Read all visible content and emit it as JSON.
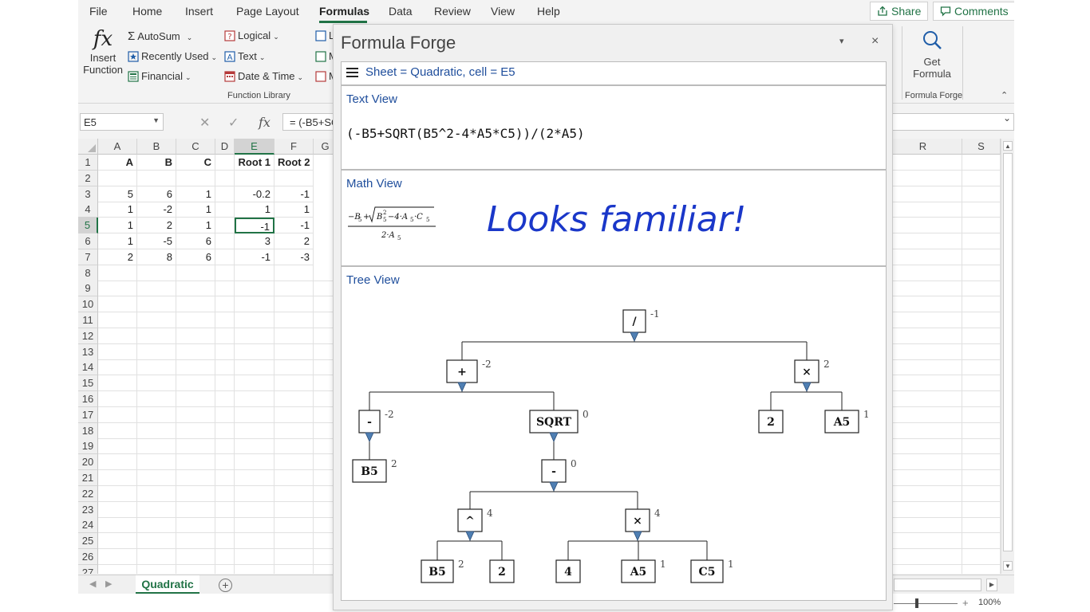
{
  "menu": {
    "tabs": [
      "File",
      "Home",
      "Insert",
      "Page Layout",
      "Formulas",
      "Data",
      "Review",
      "View",
      "Help"
    ],
    "active_tab": "Formulas",
    "share_label": "Share",
    "comments_label": "Comments"
  },
  "ribbon": {
    "insert_function_line1": "Insert",
    "insert_function_line2": "Function",
    "fx_glyph": "fx",
    "autosum": "AutoSum",
    "recently_used": "Recently Used",
    "financial": "Financial",
    "logical": "Logical",
    "text": "Text",
    "date_time": "Date & Time",
    "lookup_clip": "L",
    "math_clip": "M",
    "more_clip": "M",
    "function_library_label": "Function Library",
    "get_formula_line1": "Get",
    "get_formula_line2": "Formula",
    "formula_forge_group_label": "Formula Forge"
  },
  "formula_bar": {
    "name_box": "E5",
    "formula_text": "= (-B5+SQRT(B5^2-4*A5*C5))/(2*A5)"
  },
  "grid": {
    "columns": [
      "A",
      "B",
      "C",
      "D",
      "E",
      "F",
      "G",
      "R",
      "S"
    ],
    "row_numbers": [
      "1",
      "2",
      "3",
      "4",
      "5",
      "6",
      "7",
      "8",
      "9",
      "10",
      "11",
      "12",
      "13",
      "14",
      "15",
      "16",
      "17",
      "18",
      "19",
      "20",
      "21",
      "22",
      "23",
      "24",
      "25",
      "26",
      "27"
    ],
    "headers": [
      "A",
      "B",
      "C",
      "",
      "Root 1",
      "Root 2"
    ],
    "rows": [
      [
        "",
        "",
        "",
        "",
        "",
        ""
      ],
      [
        "5",
        "6",
        "1",
        "",
        "-0.2",
        "-1"
      ],
      [
        "1",
        "-2",
        "1",
        "",
        "1",
        "1"
      ],
      [
        "1",
        "2",
        "1",
        "",
        "-1",
        "-1"
      ],
      [
        "1",
        "-5",
        "6",
        "",
        "3",
        "2"
      ],
      [
        "2",
        "8",
        "6",
        "",
        "-1",
        "-3"
      ]
    ],
    "selected_cell": "E5"
  },
  "sheet_tabs": {
    "active": "Quadratic",
    "add_label": "+"
  },
  "status": {
    "zoom": "100%",
    "zoom_plus": "+"
  },
  "formula_forge": {
    "title": "Formula Forge",
    "pin_glyph": "▾",
    "close_glyph": "×",
    "context": "Sheet = Quadratic, cell = E5",
    "text_view_title": "Text View",
    "text_view_formula": "(-B5+SQRT(B5^2-4*A5*C5))/(2*A5)",
    "math_view_title": "Math View",
    "math_view_caption": "Looks familiar!",
    "math_numerator": [
      "−B",
      "5",
      "+",
      "B",
      "5",
      "2",
      "−4·A",
      "5",
      "·C",
      "5"
    ],
    "math_denominator": [
      "2·A",
      "5"
    ],
    "tree_view_title": "Tree View",
    "tree": {
      "nodes": [
        {
          "id": "div",
          "label": "/",
          "value": "-1"
        },
        {
          "id": "plus",
          "label": "+",
          "value": "-2"
        },
        {
          "id": "times1",
          "label": "×",
          "value": "2"
        },
        {
          "id": "neg",
          "label": "-",
          "value": "-2"
        },
        {
          "id": "sqrt",
          "label": "SQRT",
          "value": "0"
        },
        {
          "id": "two1",
          "label": "2",
          "value": ""
        },
        {
          "id": "a5a",
          "label": "A5",
          "value": "1"
        },
        {
          "id": "b5a",
          "label": "B5",
          "value": "2"
        },
        {
          "id": "minus",
          "label": "-",
          "value": "0"
        },
        {
          "id": "pow",
          "label": "^",
          "value": "4"
        },
        {
          "id": "times2",
          "label": "×",
          "value": "4"
        },
        {
          "id": "b5b",
          "label": "B5",
          "value": "2"
        },
        {
          "id": "two2",
          "label": "2",
          "value": ""
        },
        {
          "id": "four",
          "label": "4",
          "value": ""
        },
        {
          "id": "a5b",
          "label": "A5",
          "value": "1"
        },
        {
          "id": "c5",
          "label": "C5",
          "value": "1"
        }
      ],
      "edges": [
        [
          "div",
          "plus"
        ],
        [
          "div",
          "times1"
        ],
        [
          "plus",
          "neg"
        ],
        [
          "plus",
          "sqrt"
        ],
        [
          "times1",
          "two1"
        ],
        [
          "times1",
          "a5a"
        ],
        [
          "neg",
          "b5a"
        ],
        [
          "sqrt",
          "minus"
        ],
        [
          "minus",
          "pow"
        ],
        [
          "minus",
          "times2"
        ],
        [
          "pow",
          "b5b"
        ],
        [
          "pow",
          "two2"
        ],
        [
          "times2",
          "four"
        ],
        [
          "times2",
          "a5b"
        ],
        [
          "times2",
          "c5"
        ]
      ]
    }
  }
}
